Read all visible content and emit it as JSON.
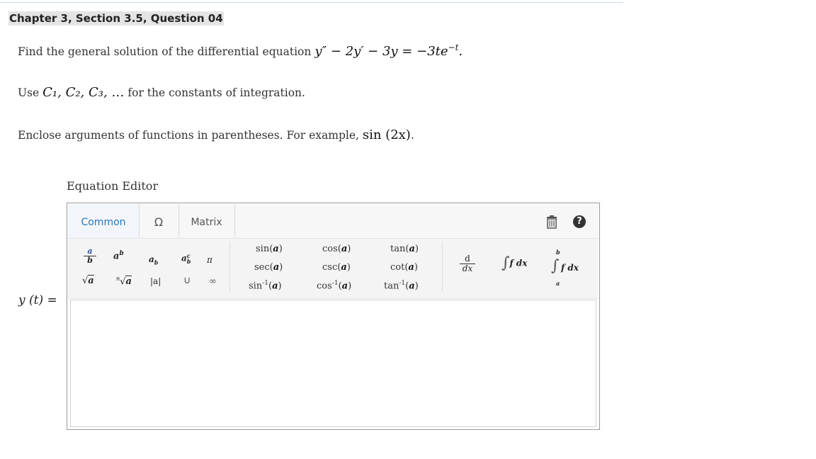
{
  "question": {
    "title": "Chapter 3, Section 3.5, Question 04",
    "prompt_text": "Find the general solution of the differential equation",
    "equation": "y″ − 2y′ − 3y = −3te",
    "equation_exp": "−t",
    "equation_end": ".",
    "constants_pre": "Use",
    "constants_math": "C₁, C₂, C₃, …",
    "constants_post": "for the constants of integration.",
    "args_text": "Enclose arguments of functions in parentheses. For example,",
    "args_example": "sin (2x)",
    "args_end": "."
  },
  "editor": {
    "label": "Equation Editor",
    "tabs": {
      "common": "Common",
      "symbols": "Ω",
      "matrix": "Matrix"
    },
    "help": "?",
    "palette": {
      "frac_num": "a",
      "frac_den": "b",
      "power_base": "a",
      "power_exp": "b",
      "sub_base": "a",
      "sub_idx": "b",
      "subsup_base": "a",
      "subsup_sub": "b",
      "subsup_sup": "c",
      "pi": "π",
      "sqrt": "a",
      "nroot_index": "n",
      "nroot": "a",
      "abs": "|a|",
      "union": "∪",
      "infinity": "∞",
      "trig": [
        "sin",
        "cos",
        "tan",
        "sec",
        "csc",
        "cot",
        "sin",
        "cos",
        "tan"
      ],
      "trig_arg": "a",
      "inverse_exp": "-1",
      "deriv_num": "d",
      "deriv_den": "dx",
      "integral": "∫",
      "integrand": "f dx",
      "def_upper": "b",
      "def_lower": "a"
    }
  },
  "answer": {
    "label": "y (t) =",
    "value": ""
  }
}
